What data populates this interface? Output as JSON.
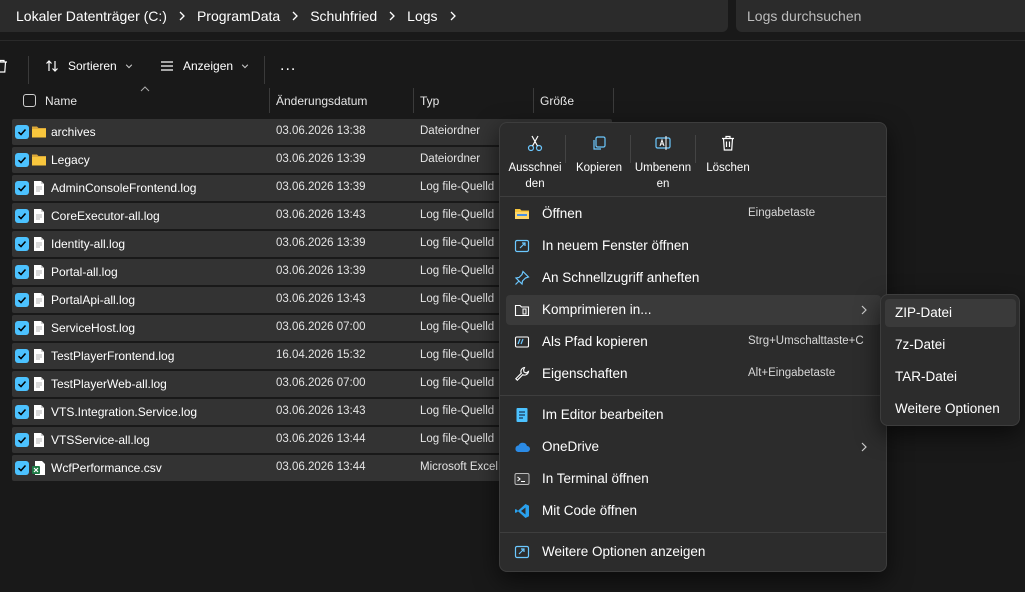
{
  "breadcrumb": [
    "Lokaler Datenträger (C:)",
    "ProgramData",
    "Schuhfried",
    "Logs"
  ],
  "search": {
    "placeholder": "Logs durchsuchen"
  },
  "toolbar": {
    "sort_label": "Sortieren",
    "view_label": "Anzeigen",
    "more_label": "..."
  },
  "columns": {
    "name": "Name",
    "date": "Änderungsdatum",
    "type": "Typ",
    "size": "Größe"
  },
  "files": [
    {
      "name": "archives",
      "date": "03.06.2026 13:38",
      "type": "Dateiordner",
      "icon": "folder"
    },
    {
      "name": "Legacy",
      "date": "03.06.2026 13:39",
      "type": "Dateiordner",
      "icon": "folder"
    },
    {
      "name": "AdminConsoleFrontend.log",
      "date": "03.06.2026 13:39",
      "type": "Log file-Quelld",
      "icon": "file"
    },
    {
      "name": "CoreExecutor-all.log",
      "date": "03.06.2026 13:43",
      "type": "Log file-Quelld",
      "icon": "file"
    },
    {
      "name": "Identity-all.log",
      "date": "03.06.2026 13:39",
      "type": "Log file-Quelld",
      "icon": "file"
    },
    {
      "name": "Portal-all.log",
      "date": "03.06.2026 13:39",
      "type": "Log file-Quelld",
      "icon": "file"
    },
    {
      "name": "PortalApi-all.log",
      "date": "03.06.2026 13:43",
      "type": "Log file-Quelld",
      "icon": "file"
    },
    {
      "name": "ServiceHost.log",
      "date": "03.06.2026 07:00",
      "type": "Log file-Quelld",
      "icon": "file"
    },
    {
      "name": "TestPlayerFrontend.log",
      "date": "16.04.2026 15:32",
      "type": "Log file-Quelld",
      "icon": "file"
    },
    {
      "name": "TestPlayerWeb-all.log",
      "date": "03.06.2026 07:00",
      "type": "Log file-Quelld",
      "icon": "file"
    },
    {
      "name": "VTS.Integration.Service.log",
      "date": "03.06.2026 13:43",
      "type": "Log file-Quelld",
      "icon": "file"
    },
    {
      "name": "VTSService-all.log",
      "date": "03.06.2026 13:44",
      "type": "Log file-Quelld",
      "icon": "file"
    },
    {
      "name": "WcfPerformance.csv",
      "date": "03.06.2026 13:44",
      "type": "Microsoft Excel",
      "icon": "excel"
    }
  ],
  "context_menu": {
    "quick_actions": [
      {
        "label": "Ausschneiden",
        "icon": "scissors-icon"
      },
      {
        "label": "Kopieren",
        "icon": "copy-icon"
      },
      {
        "label": "Umbenennen",
        "icon": "rename-icon"
      },
      {
        "label": "Löschen",
        "icon": "trash-icon"
      }
    ],
    "items": [
      {
        "label": "Öffnen",
        "shortcut": "Eingabetaste",
        "icon": "folder-open-icon"
      },
      {
        "label": "In neuem Fenster öffnen",
        "shortcut": "",
        "icon": "new-window-icon"
      },
      {
        "label": "An Schnellzugriff anheften",
        "shortcut": "",
        "icon": "pin-icon"
      },
      {
        "label": "Komprimieren in...",
        "shortcut": "",
        "icon": "archive-icon"
      },
      {
        "label": "Als Pfad kopieren",
        "shortcut": "Strg+Umschalttaste+C",
        "icon": "copy-path-icon"
      },
      {
        "label": "Eigenschaften",
        "shortcut": "Alt+Eingabetaste",
        "icon": "wrench-icon"
      },
      {
        "label": "Im Editor bearbeiten",
        "shortcut": "",
        "icon": "notepad-icon"
      },
      {
        "label": "OneDrive",
        "shortcut": "",
        "icon": "cloud-icon"
      },
      {
        "label": "In Terminal öffnen",
        "shortcut": "",
        "icon": "terminal-icon"
      },
      {
        "label": "Mit Code öffnen",
        "shortcut": "",
        "icon": "vscode-icon"
      },
      {
        "label": "Weitere Optionen anzeigen",
        "shortcut": "",
        "icon": "more-options-icon"
      }
    ]
  },
  "submenu": [
    "ZIP-Datei",
    "7z-Datei",
    "TAR-Datei",
    "Weitere Optionen"
  ],
  "colors": {
    "accent": "#4cc2ff",
    "background": "#191919",
    "menu": "#2c2c2c",
    "folder": "#f8c63d"
  }
}
